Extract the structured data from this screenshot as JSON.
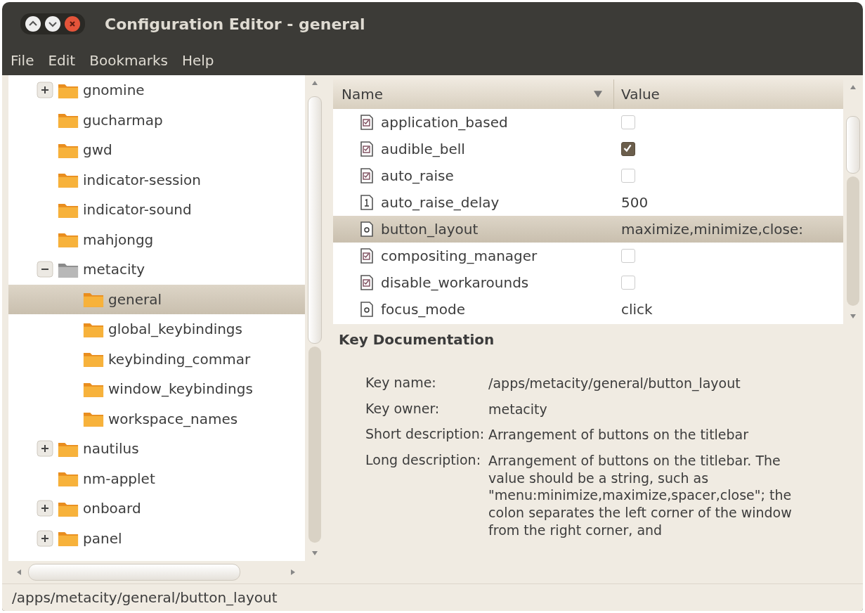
{
  "window": {
    "title": "Configuration Editor - general"
  },
  "menu": [
    "File",
    "Edit",
    "Bookmarks",
    "Help"
  ],
  "tree": [
    {
      "label": "gnomine",
      "expandable": true,
      "expanded": false,
      "selected": false
    },
    {
      "label": "gucharmap",
      "expandable": false,
      "selected": false
    },
    {
      "label": "gwd",
      "expandable": false,
      "selected": false
    },
    {
      "label": "indicator-session",
      "expandable": false,
      "selected": false
    },
    {
      "label": "indicator-sound",
      "expandable": false,
      "selected": false
    },
    {
      "label": "mahjongg",
      "expandable": false,
      "selected": false
    },
    {
      "label": "metacity",
      "expandable": true,
      "expanded": true,
      "selected": false,
      "children": [
        {
          "label": "general",
          "expandable": false,
          "selected": true
        },
        {
          "label": "global_keybindings",
          "expandable": false,
          "selected": false
        },
        {
          "label": "keybinding_commar",
          "expandable": false,
          "selected": false
        },
        {
          "label": "window_keybindings",
          "expandable": false,
          "selected": false
        },
        {
          "label": "workspace_names",
          "expandable": false,
          "selected": false
        }
      ]
    },
    {
      "label": "nautilus",
      "expandable": true,
      "expanded": false,
      "selected": false
    },
    {
      "label": "nm-applet",
      "expandable": false,
      "selected": false
    },
    {
      "label": "onboard",
      "expandable": true,
      "expanded": false,
      "selected": false
    },
    {
      "label": "panel",
      "expandable": true,
      "expanded": false,
      "selected": false
    }
  ],
  "table": {
    "columns": [
      "Name",
      "Value"
    ],
    "rows": [
      {
        "name": "application_based",
        "kind": "bool",
        "checked": false,
        "selected": false
      },
      {
        "name": "audible_bell",
        "kind": "bool",
        "checked": true,
        "selected": false
      },
      {
        "name": "auto_raise",
        "kind": "bool",
        "checked": false,
        "selected": false
      },
      {
        "name": "auto_raise_delay",
        "kind": "int",
        "value": "500",
        "selected": false
      },
      {
        "name": "button_layout",
        "kind": "string",
        "value": "maximize,minimize,close:",
        "selected": true
      },
      {
        "name": "compositing_manager",
        "kind": "bool",
        "checked": false,
        "selected": false
      },
      {
        "name": "disable_workarounds",
        "kind": "bool",
        "checked": false,
        "selected": false
      },
      {
        "name": "focus_mode",
        "kind": "string",
        "value": "click",
        "selected": false
      }
    ]
  },
  "documentation": {
    "heading": "Key Documentation",
    "fields": [
      {
        "label": "Key name:",
        "value": "/apps/metacity/general/button_layout"
      },
      {
        "label": "Key owner:",
        "value": "metacity"
      },
      {
        "label": "Short description:",
        "value": "Arrangement of buttons on the titlebar"
      },
      {
        "label": "Long description:",
        "value": "Arrangement of buttons on the titlebar. The value should be a string, such as \"menu:minimize,maximize,spacer,close\"; the colon separates the left corner of the window from the right corner, and"
      }
    ]
  },
  "status_bar": "/apps/metacity/general/button_layout"
}
